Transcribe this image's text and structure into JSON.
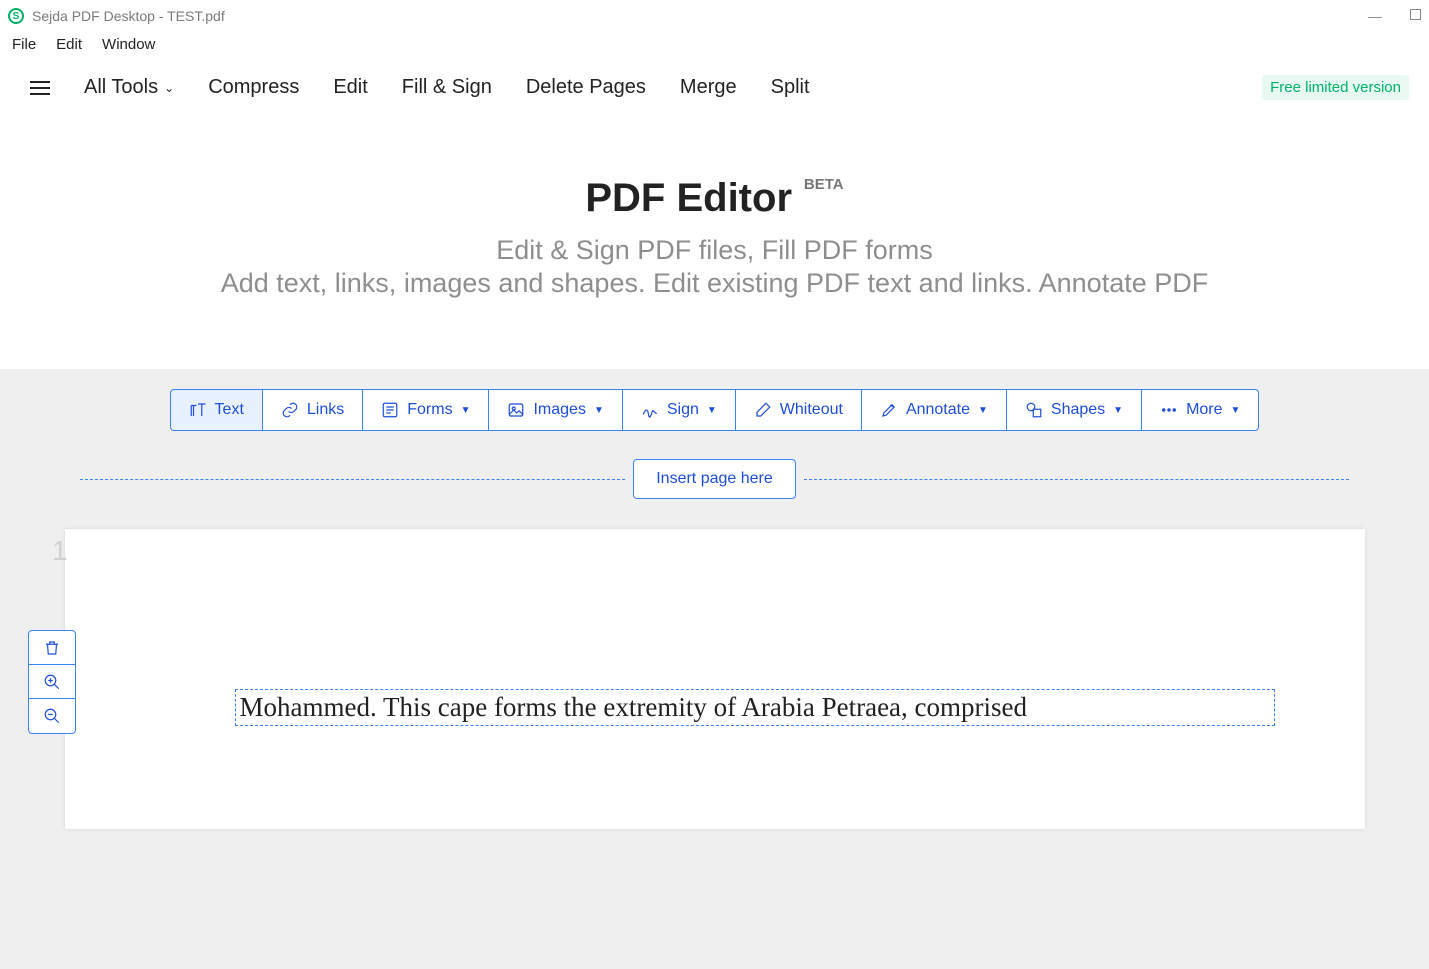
{
  "titlebar": {
    "title": "Sejda PDF Desktop - TEST.pdf"
  },
  "menubar": {
    "file": "File",
    "edit": "Edit",
    "window": "Window"
  },
  "topnav": {
    "alltools": "All Tools",
    "compress": "Compress",
    "edit": "Edit",
    "fillsign": "Fill & Sign",
    "deletepages": "Delete Pages",
    "merge": "Merge",
    "split": "Split",
    "badge": "Free limited version"
  },
  "hero": {
    "title": "PDF Editor",
    "beta": "BETA",
    "sub1": "Edit & Sign PDF files, Fill PDF forms",
    "sub2": "Add text, links, images and shapes. Edit existing PDF text and links. Annotate PDF"
  },
  "tools": {
    "text": "Text",
    "links": "Links",
    "forms": "Forms",
    "images": "Images",
    "sign": "Sign",
    "whiteout": "Whiteout",
    "annotate": "Annotate",
    "shapes": "Shapes",
    "more": "More"
  },
  "insert": {
    "label": "Insert page here"
  },
  "page": {
    "number": "1",
    "text": "Mohammed. This cape forms the extremity of Arabia Petraea, comprised"
  }
}
